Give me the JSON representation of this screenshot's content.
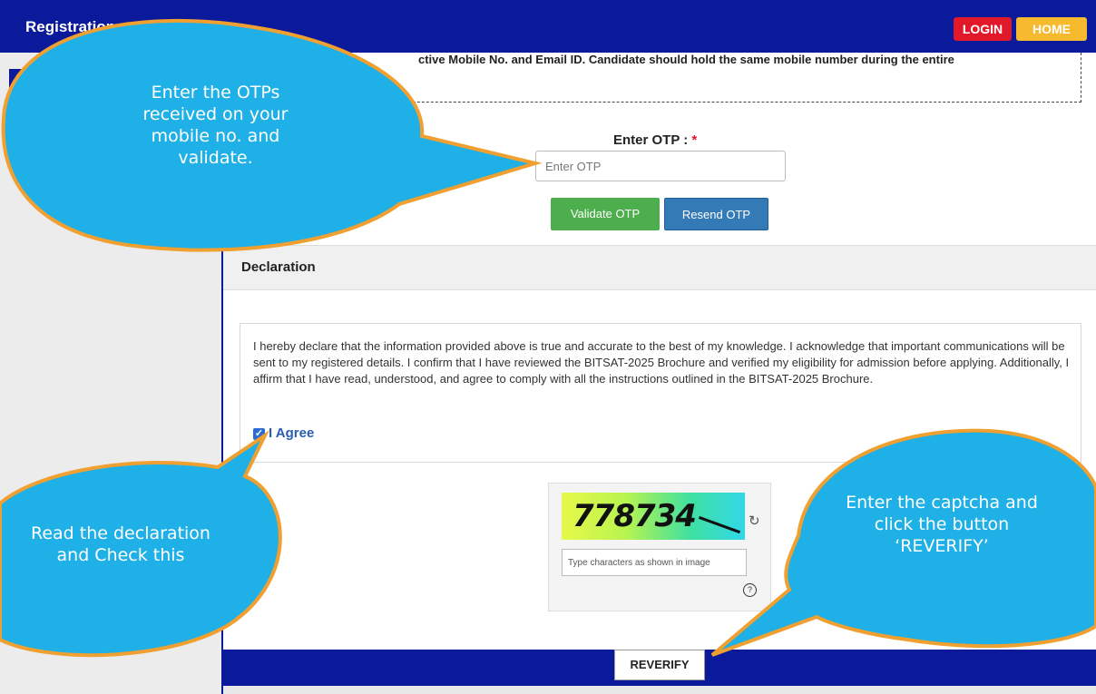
{
  "header": {
    "title": "Registration",
    "login_label": "LOGIN",
    "home_label": "HOME"
  },
  "notice": {
    "text": "ctive Mobile No. and Email ID. Candidate should hold the same mobile number during the entire"
  },
  "otp": {
    "label": "Enter OTP :",
    "required_mark": "*",
    "placeholder": "Enter OTP",
    "validate_label": "Validate OTP",
    "resend_label": "Resend OTP"
  },
  "declaration": {
    "title": "Declaration",
    "text": "I hereby declare that the information provided above is true and accurate to the best of my knowledge. I acknowledge that important communications will be sent to my registered details. I confirm that I have reviewed the BITSAT-2025 Brochure and verified my eligibility for admission before applying. Additionally, I affirm that I have read, understood, and agree to comply with all the instructions outlined in the BITSAT-2025 Brochure.",
    "agree_label": "I Agree",
    "agree_checked": true
  },
  "captcha": {
    "code": "778734",
    "placeholder": "Type characters as shown in image",
    "refresh_icon": "refresh-icon",
    "help_icon": "help-icon",
    "help_glyph": "?"
  },
  "actions": {
    "reverify_label": "REVERIFY"
  },
  "callouts": {
    "otp": "Enter the OTPs received on your mobile no. and validate.",
    "declaration": "Read the declaration and Check this",
    "captcha": "Enter the captcha and click the button ‘REVERIFY’"
  },
  "colors": {
    "primary_navy": "#0a1a9a",
    "login_red": "#e0182a",
    "home_yellow": "#f7b92e",
    "validate_green": "#4cae4c",
    "resend_blue": "#337ab7",
    "callout_cyan": "#1eb0e6",
    "callout_border": "#f0a030"
  }
}
